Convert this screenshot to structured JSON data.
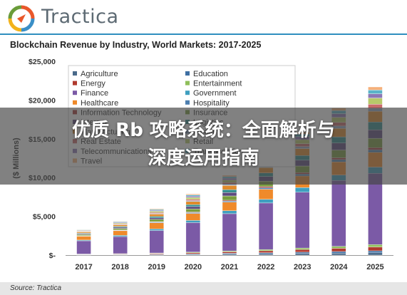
{
  "brand": {
    "name": "Tractica",
    "logo_colors": [
      "#e9572a",
      "#3a8fc7",
      "#f2b21b",
      "#6a9c3a"
    ]
  },
  "source": "Source: Tractica",
  "overlay": {
    "line1": "优质 Rb 攻略系统：全面解析与",
    "line2": "深度运用指南"
  },
  "chart_data": {
    "type": "bar",
    "stacked": true,
    "title": "Blockchain Revenue by Industry, World Markets: 2017-2025",
    "xlabel": "",
    "ylabel": "($ Millions)",
    "ylim": [
      0,
      25000
    ],
    "yticks": [
      "$-",
      "$5,000",
      "$10,000",
      "$15,000",
      "$20,000",
      "$25,000"
    ],
    "grid": false,
    "legend_position": "top-left",
    "categories": [
      "2017",
      "2018",
      "2019",
      "2020",
      "2021",
      "2022",
      "2023",
      "2024",
      "2025"
    ],
    "series": [
      {
        "name": "Agriculture",
        "color": "#4a6a8a",
        "values": [
          40,
          50,
          70,
          100,
          140,
          180,
          220,
          260,
          300
        ]
      },
      {
        "name": "Education",
        "color": "#3e6fa3",
        "values": [
          30,
          40,
          50,
          70,
          100,
          130,
          160,
          200,
          250
        ]
      },
      {
        "name": "Energy",
        "color": "#b03a2e",
        "values": [
          40,
          60,
          90,
          130,
          180,
          250,
          330,
          420,
          500
        ]
      },
      {
        "name": "Entertainment",
        "color": "#8fbf5a",
        "values": [
          30,
          40,
          60,
          90,
          120,
          160,
          200,
          250,
          300
        ]
      },
      {
        "name": "Finance",
        "color": "#7b5aa6",
        "values": [
          1700,
          2200,
          2900,
          3800,
          4800,
          6000,
          7200,
          8500,
          9200
        ]
      },
      {
        "name": "Government",
        "color": "#3f9fbf",
        "values": [
          100,
          150,
          200,
          280,
          380,
          480,
          600,
          700,
          800
        ]
      },
      {
        "name": "Healthcare",
        "color": "#ef8a2b",
        "values": [
          500,
          600,
          800,
          900,
          1100,
          1300,
          1500,
          1700,
          1900
        ]
      },
      {
        "name": "Hospitality",
        "color": "#4d7fb0",
        "values": [
          40,
          60,
          80,
          110,
          150,
          190,
          240,
          290,
          340
        ]
      },
      {
        "name": "Information Technology",
        "color": "#a83a36",
        "values": [
          30,
          40,
          60,
          80,
          110,
          150,
          190,
          230,
          270
        ]
      },
      {
        "name": "Insurance",
        "color": "#7a9d3e",
        "values": [
          150,
          200,
          300,
          400,
          550,
          700,
          850,
          1000,
          1200
        ]
      },
      {
        "name": "Internet",
        "color": "#5c4a7e",
        "values": [
          100,
          150,
          200,
          300,
          450,
          600,
          750,
          900,
          1100
        ]
      },
      {
        "name": "Logistics",
        "color": "#2f8c8c",
        "values": [
          80,
          120,
          180,
          250,
          350,
          450,
          600,
          800,
          1000
        ]
      },
      {
        "name": "Manufacturing",
        "color": "#e08a2a",
        "values": [
          150,
          200,
          300,
          400,
          550,
          700,
          900,
          1100,
          1400
        ]
      },
      {
        "name": "Media",
        "color": "#8fa8c8",
        "values": [
          40,
          60,
          80,
          120,
          160,
          200,
          250,
          300,
          350
        ]
      },
      {
        "name": "Real Estate",
        "color": "#c96a6a",
        "values": [
          60,
          80,
          120,
          170,
          230,
          300,
          380,
          470,
          550
        ]
      },
      {
        "name": "Retail",
        "color": "#b7c96a",
        "values": [
          80,
          120,
          170,
          240,
          320,
          420,
          520,
          650,
          800
        ]
      },
      {
        "name": "Telecommunications",
        "color": "#8b77b5",
        "values": [
          60,
          80,
          120,
          170,
          230,
          300,
          380,
          470,
          550
        ]
      },
      {
        "name": "Transportation",
        "color": "#5ab3c8",
        "values": [
          60,
          80,
          110,
          150,
          200,
          260,
          330,
          400,
          480
        ]
      },
      {
        "name": "Travel",
        "color": "#f5b07a",
        "values": [
          40,
          60,
          90,
          130,
          170,
          220,
          270,
          330,
          400
        ]
      }
    ]
  }
}
